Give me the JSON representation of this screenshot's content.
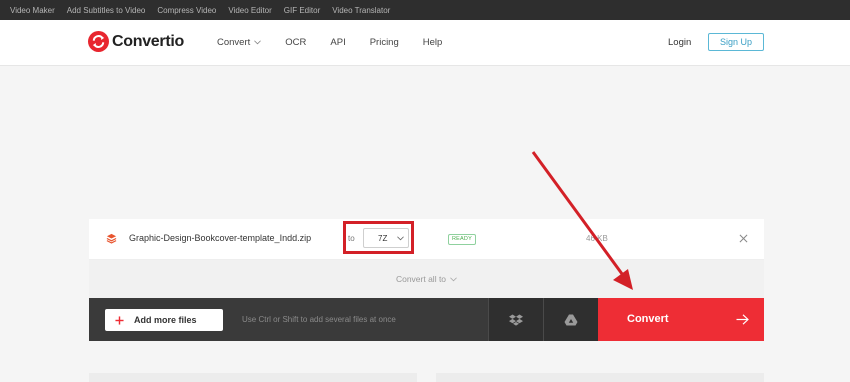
{
  "topbar": {
    "links": [
      "Video Maker",
      "Add Subtitles to Video",
      "Compress Video",
      "Video Editor",
      "GIF Editor",
      "Video Translator"
    ]
  },
  "header": {
    "logo_text": "Convertio",
    "nav": {
      "convert": "Convert",
      "ocr": "OCR",
      "api": "API",
      "pricing": "Pricing",
      "help": "Help"
    },
    "login": "Login",
    "signup": "Sign Up"
  },
  "file": {
    "name": "Graphic-Design-Bookcover-template_Indd.zip",
    "to_label": "to",
    "format": "7Z",
    "status": "READY",
    "size": "46 KB"
  },
  "convert_all": "Convert all to",
  "actions": {
    "add_files": "Add more files",
    "hint": "Use Ctrl or Shift to add several files at once",
    "convert": "Convert"
  },
  "colors": {
    "accent_red": "#ee2d35",
    "annotation_red": "#d32027",
    "ready_green": "#4caf50",
    "signup_blue": "#3a9fc5"
  },
  "icons": [
    "convertio-logo-icon",
    "chevron-down-icon",
    "file-layers-icon",
    "close-icon",
    "plus-icon",
    "dropbox-icon",
    "google-drive-icon",
    "arrow-right-icon"
  ]
}
